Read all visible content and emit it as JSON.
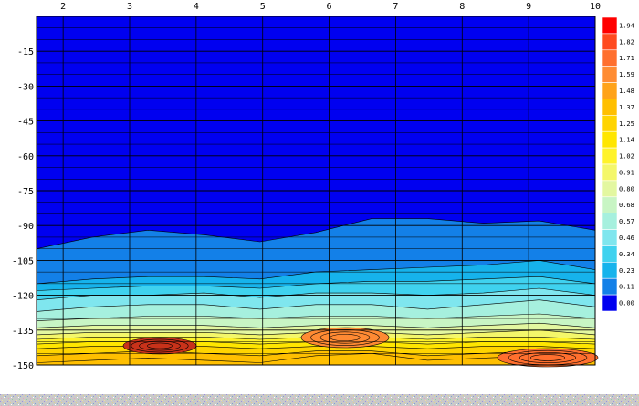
{
  "chart_data": {
    "type": "heatmap",
    "title": "",
    "xlabel": "",
    "ylabel": "",
    "x": [
      1.6,
      2,
      3,
      4,
      5,
      6,
      7,
      8,
      9,
      10
    ],
    "x_ticks": [
      2,
      3,
      4,
      5,
      6,
      7,
      8,
      9,
      10
    ],
    "x_tick_labels": [
      "2",
      "3",
      "4",
      "5",
      "6",
      "7",
      "8",
      "9",
      "10"
    ],
    "y_ticks": [
      -15,
      -30,
      -45,
      -60,
      -75,
      -90,
      -105,
      -120,
      -135,
      -150
    ],
    "y_tick_labels": [
      "-15",
      "-30",
      "-45",
      "-60",
      "-75",
      "-90",
      "-105",
      "-120",
      "-135",
      "-150"
    ],
    "xlim": [
      1.6,
      10
    ],
    "ylim": [
      -150,
      0
    ],
    "grid": true,
    "legend_position": "right",
    "colorbar": {
      "labels": [
        "1.94",
        "1.82",
        "1.71",
        "1.59",
        "1.48",
        "1.37",
        "1.25",
        "1.14",
        "1.02",
        "0.91",
        "0.80",
        "0.68",
        "0.57",
        "0.46",
        "0.34",
        "0.23",
        "0.11",
        "0.00"
      ],
      "colors": [
        "#ff0000",
        "#ff4a1f",
        "#ff6f2e",
        "#ff8c33",
        "#ffa31a",
        "#ffbf00",
        "#ffd400",
        "#ffe600",
        "#fff32a",
        "#f4f76a",
        "#e3f7a0",
        "#c8f5c4",
        "#a6f0de",
        "#7fe6ee",
        "#3fd2ef",
        "#16b3ec",
        "#1380e8",
        "#0000f0"
      ]
    },
    "boundaries": {
      "0.00": [
        -100,
        -95,
        -92,
        -94,
        -97,
        -93,
        -87,
        -87,
        -89,
        -88,
        -92
      ],
      "0.11": [
        -115,
        -113,
        -112,
        -112,
        -113,
        -110,
        -109,
        -108,
        -107,
        -105,
        -109
      ],
      "0.23": [
        -118,
        -117,
        -116,
        -116,
        -117,
        -115,
        -114,
        -114,
        -113,
        -112,
        -115
      ],
      "0.34": [
        -122,
        -120,
        -120,
        -119,
        -121,
        -119,
        -119,
        -120,
        -119,
        -117,
        -120
      ],
      "0.46": [
        -127,
        -125,
        -124,
        -124,
        -126,
        -124,
        -124,
        -126,
        -124,
        -122,
        -125
      ],
      "0.57": [
        -131,
        -130,
        -129,
        -129,
        -130,
        -129,
        -129,
        -130,
        -129,
        -128,
        -130
      ],
      "0.68": [
        -134,
        -133,
        -133,
        -133,
        -134,
        -133,
        -133,
        -134,
        -133,
        -132,
        -134
      ],
      "0.80": [
        -137,
        -136,
        -136,
        -136,
        -137,
        -136,
        -136,
        -137,
        -136,
        -135,
        -137
      ],
      "0.91": [
        -139,
        -138,
        -138,
        -138,
        -139,
        -138,
        -138,
        -139,
        -138,
        -138,
        -139
      ],
      "1.02": [
        -141,
        -140,
        -140,
        -140,
        -141,
        -140,
        -140,
        -141,
        -140,
        -140,
        -141
      ],
      "1.14": [
        -143,
        -142,
        -142,
        -142,
        -143,
        -142,
        -142,
        -143,
        -142,
        -142,
        -143
      ],
      "1.25": [
        -146,
        -145,
        -144,
        -145,
        -146,
        -144,
        -144,
        -146,
        -145,
        -144,
        -146
      ],
      "1.37": [
        -149,
        -148,
        -147,
        -148,
        -149,
        -146,
        -145,
        -148,
        -147,
        -146,
        -148
      ]
    }
  }
}
